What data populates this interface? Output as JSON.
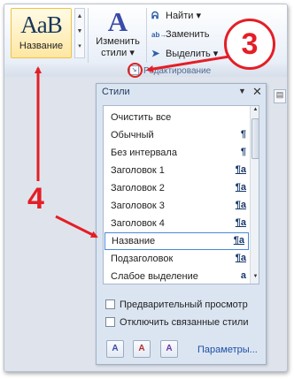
{
  "ribbon": {
    "style_tile": {
      "sample": "AaB",
      "label": "Название"
    },
    "change_styles": {
      "icon": "change-styles-A-icon",
      "line1": "Изменить",
      "line2": "стили"
    },
    "editing": {
      "find": "Найти",
      "replace": "Заменить",
      "select": "Выделить",
      "group_label": "Редактирование"
    }
  },
  "callouts": {
    "three": "3",
    "four": "4"
  },
  "styles_pane": {
    "title": "Стили",
    "items": [
      {
        "name": "Очистить все",
        "mark": ""
      },
      {
        "name": "Обычный",
        "mark": "¶"
      },
      {
        "name": "Без интервала",
        "mark": "¶"
      },
      {
        "name": "Заголовок 1",
        "mark": "¶a"
      },
      {
        "name": "Заголовок 2",
        "mark": "¶a"
      },
      {
        "name": "Заголовок 3",
        "mark": "¶a"
      },
      {
        "name": "Заголовок 4",
        "mark": "¶a"
      },
      {
        "name": "Название",
        "mark": "¶a"
      },
      {
        "name": "Подзаголовок",
        "mark": "¶a"
      },
      {
        "name": "Слабое выделение",
        "mark": "a"
      }
    ],
    "selected_index": 7,
    "preview_checkbox": "Предварительный просмотр",
    "linked_checkbox": "Отключить связанные стили",
    "params_link": "Параметры..."
  },
  "colors": {
    "callout_red": "#e41e26",
    "selection_blue": "#4a8ad7"
  }
}
